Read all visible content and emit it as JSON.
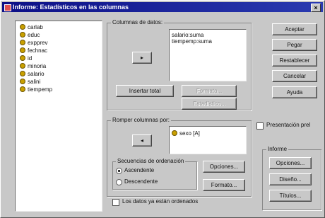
{
  "window": {
    "title": "Informe: Estadísticos en las columnas",
    "close": "×"
  },
  "variables": [
    "carlab",
    "educ",
    "expprev",
    "fechnac",
    "id",
    "minoria",
    "salario",
    "salini",
    "tiempemp"
  ],
  "data_columns": {
    "label": "Columnas de datos:",
    "items": [
      "salario:suma",
      "tiempemp:suma"
    ],
    "move_arrow": "▸",
    "insert_total": "Insertar total",
    "format": "Formato...",
    "statistics": "Estadístico..."
  },
  "break_columns": {
    "label": "Romper columnas por:",
    "items": [
      "sexo [A]"
    ],
    "move_arrow": "◂",
    "sort_sequence_label": "Secuencias de ordenación",
    "ascending": "Ascendente",
    "descending": "Descendente",
    "options": "Opciones...",
    "format": "Formato..."
  },
  "already_sorted": "Los datos ya están ordenados",
  "buttons": {
    "accept": "Aceptar",
    "paste": "Pegar",
    "reset": "Restablecer",
    "cancel": "Cancelar",
    "help": "Ayuda"
  },
  "preview": "Presentación prel",
  "report": {
    "label": "Informe",
    "options": "Opciones...",
    "layout": "Diseño...",
    "titles": "Títulos..."
  }
}
